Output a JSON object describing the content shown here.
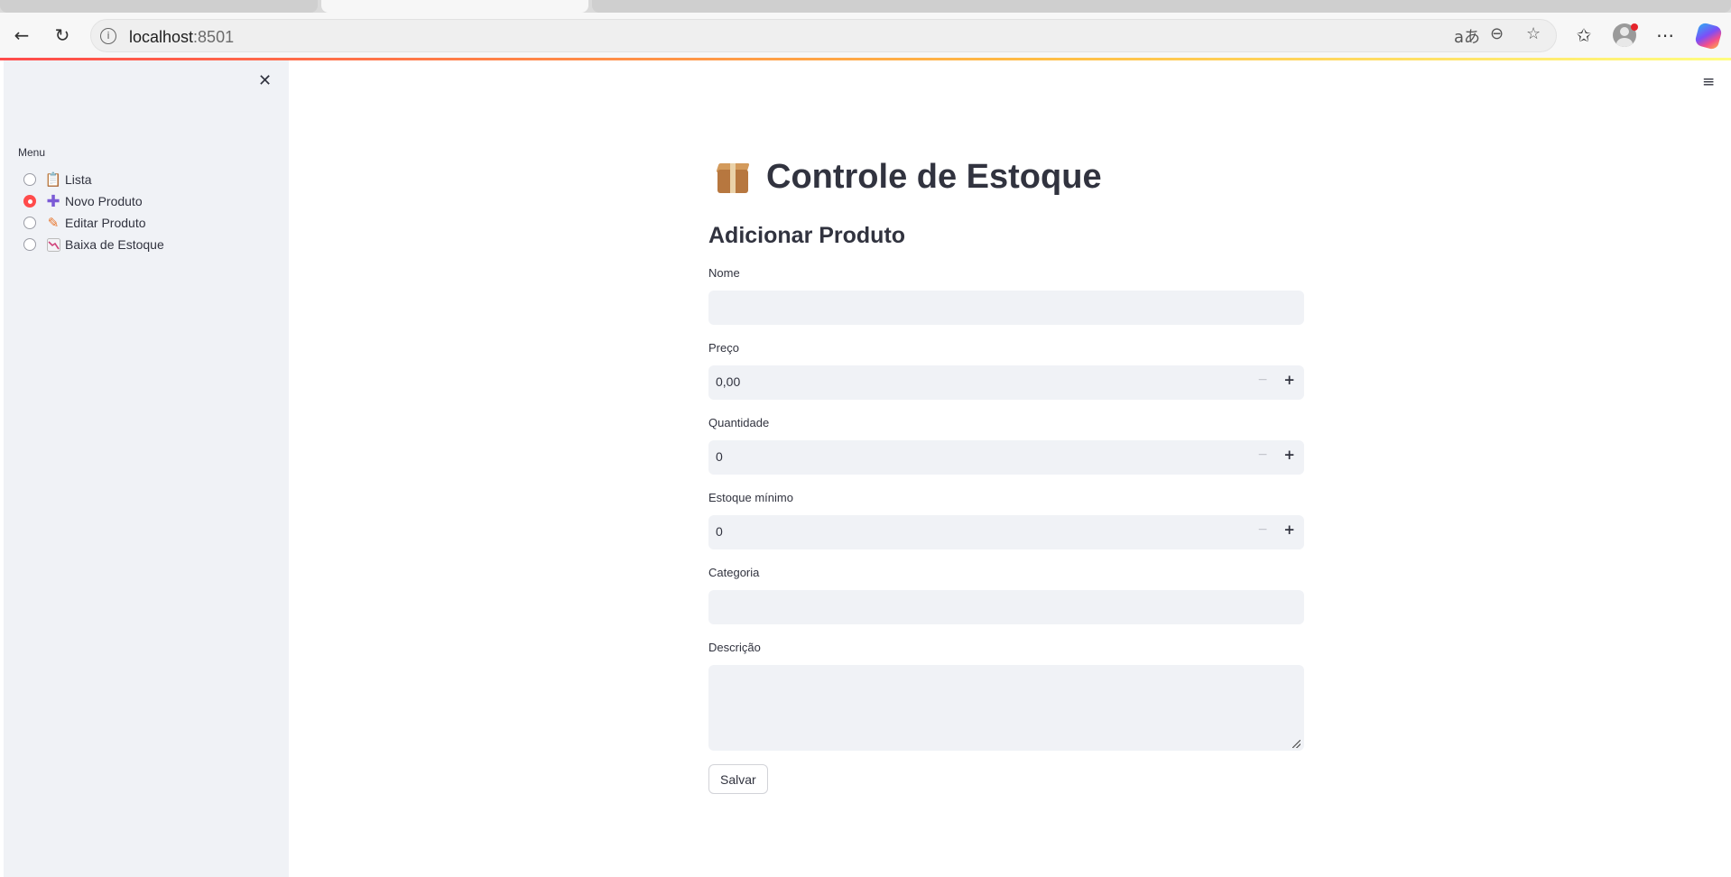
{
  "browser": {
    "url_host": "localhost",
    "url_port": ":8501"
  },
  "sidebar": {
    "menu_label": "Menu",
    "items": [
      {
        "label": "Lista",
        "icon": "clipboard-icon",
        "selected": false
      },
      {
        "label": "Novo Produto",
        "icon": "plus-icon",
        "selected": true
      },
      {
        "label": "Editar Produto",
        "icon": "pencil-icon",
        "selected": false
      },
      {
        "label": "Baixa de Estoque",
        "icon": "chart-decreasing-icon",
        "selected": false
      }
    ]
  },
  "main": {
    "title": "Controle de Estoque",
    "section_title": "Adicionar Produto",
    "fields": {
      "nome": {
        "label": "Nome",
        "value": ""
      },
      "preco": {
        "label": "Preço",
        "value": "0,00"
      },
      "quantidade": {
        "label": "Quantidade",
        "value": "0"
      },
      "estoque_minimo": {
        "label": "Estoque mínimo",
        "value": "0"
      },
      "categoria": {
        "label": "Categoria",
        "value": ""
      },
      "descricao": {
        "label": "Descrição",
        "value": ""
      }
    },
    "save_label": "Salvar"
  },
  "colors": {
    "accent": "#ff4b4b",
    "sidebar_bg": "#f0f2f6",
    "input_bg": "#f0f2f6",
    "text": "#31333f"
  }
}
